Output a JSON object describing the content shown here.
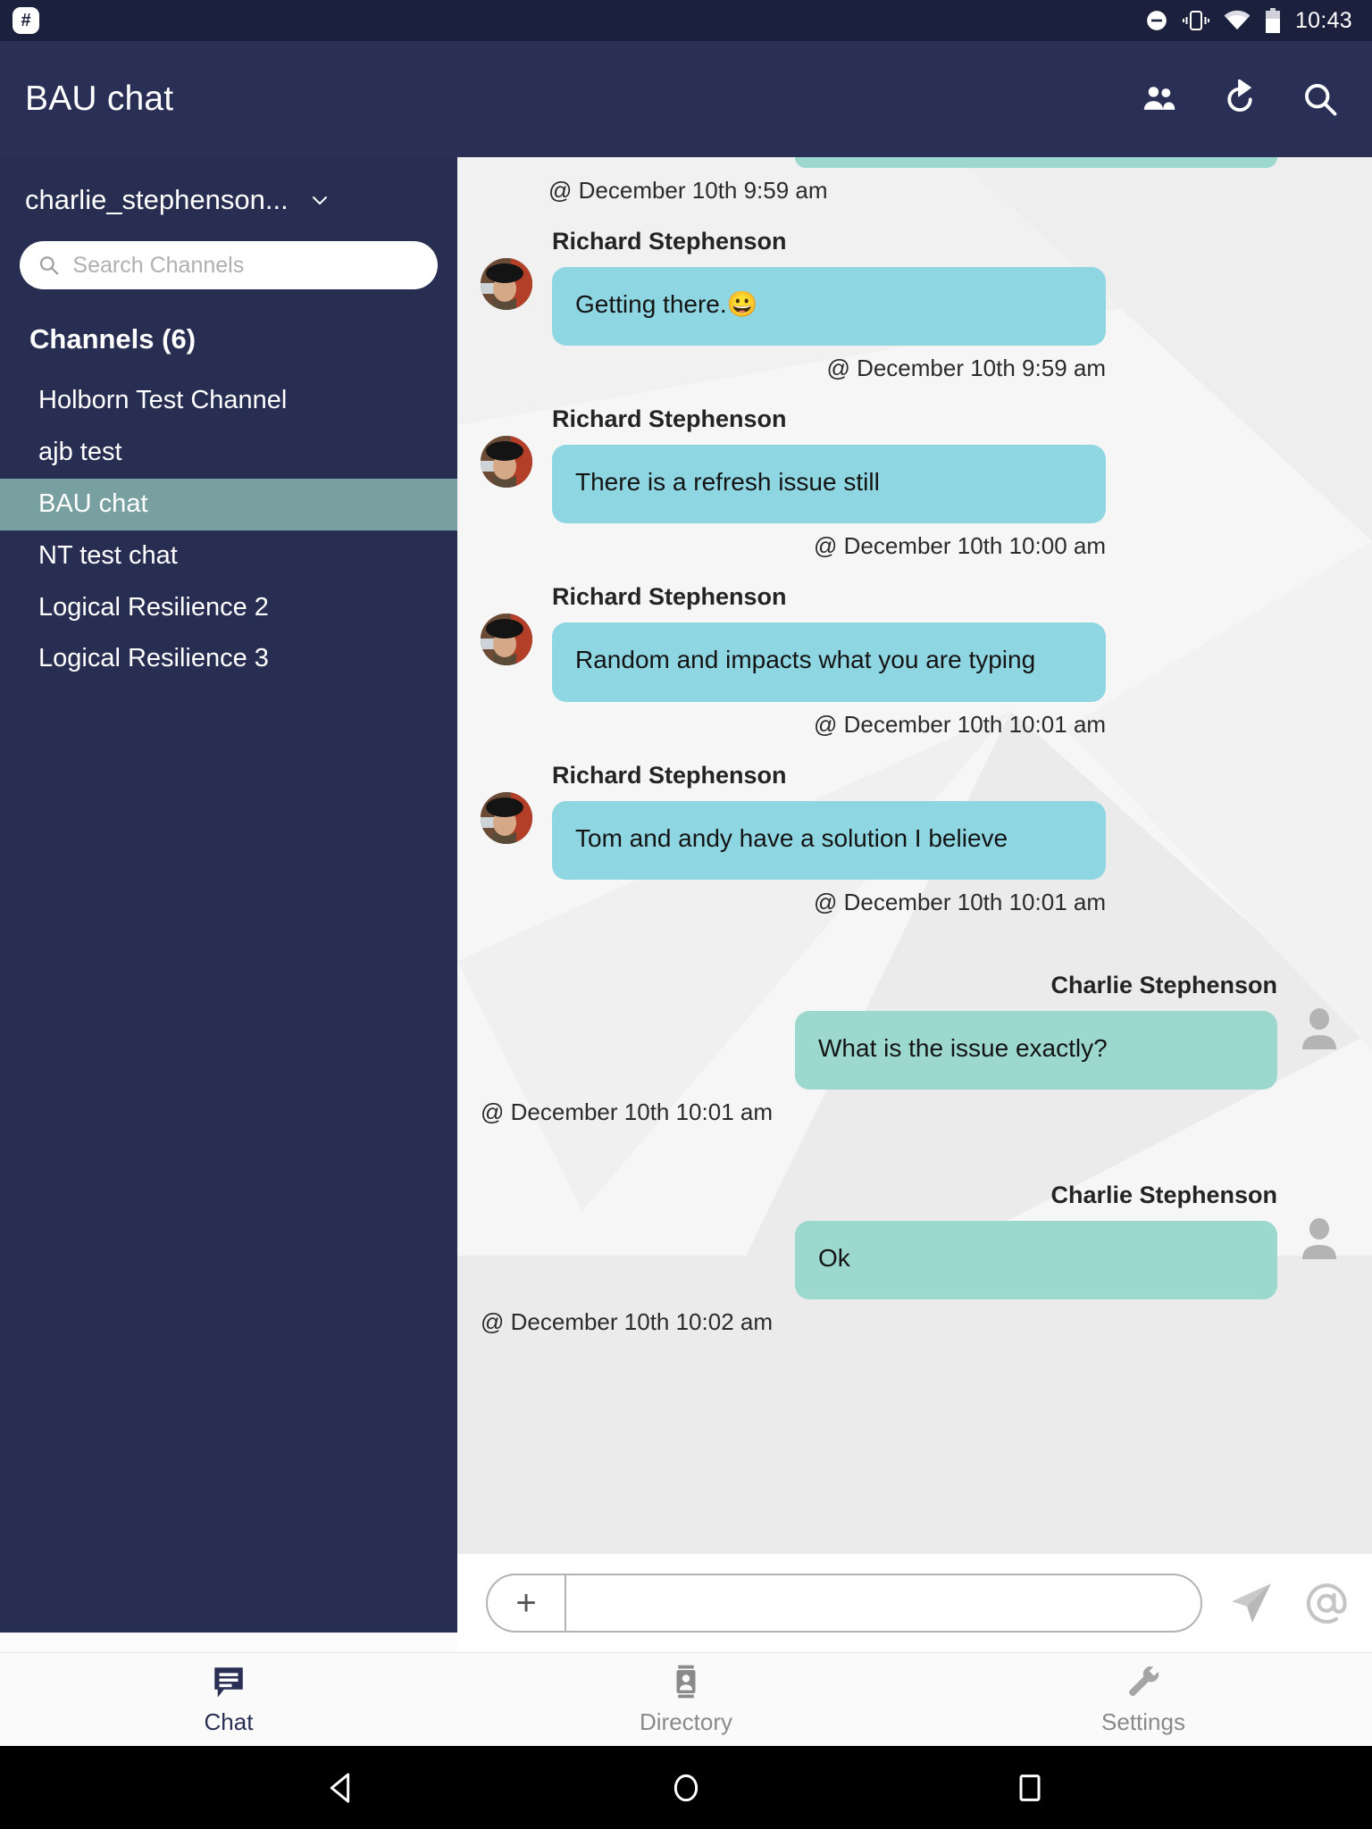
{
  "statusbar": {
    "app_icon": "hash-badge-icon",
    "icons": [
      "do-not-disturb-icon",
      "vibrate-icon",
      "wifi-icon",
      "battery-icon"
    ],
    "clock": "10:43"
  },
  "appbar": {
    "title": "BAU chat",
    "actions": [
      {
        "name": "members-icon",
        "label": "Members"
      },
      {
        "name": "refresh-icon",
        "label": "Refresh"
      },
      {
        "name": "search-icon",
        "label": "Search"
      }
    ]
  },
  "sidebar": {
    "user": "charlie_stephenson...",
    "chevron": "chevron-down-icon",
    "search": {
      "placeholder": "Search Channels",
      "value": "",
      "icon": "search-icon"
    },
    "channels_header": "Channels (6)",
    "channels": [
      {
        "label": "Holborn Test Channel",
        "active": false
      },
      {
        "label": "ajb test",
        "active": false
      },
      {
        "label": "BAU chat",
        "active": true
      },
      {
        "label": "NT test chat",
        "active": false
      },
      {
        "label": "Logical Resilience 2",
        "active": false
      },
      {
        "label": "Logical Resilience 3",
        "active": false
      }
    ]
  },
  "chat": {
    "top_partial_stamp": "@ December 10th 9:59 am",
    "messages": [
      {
        "direction": "in",
        "sender": "Richard Stephenson",
        "text": "Getting there.😀",
        "stamp": "@ December 10th 9:59 am"
      },
      {
        "direction": "in",
        "sender": "Richard Stephenson",
        "text": "There is a refresh issue still",
        "stamp": "@ December 10th 10:00 am"
      },
      {
        "direction": "in",
        "sender": "Richard Stephenson",
        "text": "Random and impacts what you are typing",
        "stamp": "@ December 10th 10:01 am"
      },
      {
        "direction": "in",
        "sender": "Richard Stephenson",
        "text": "Tom and andy have a solution I believe",
        "stamp": "@ December 10th 10:01 am"
      },
      {
        "direction": "out",
        "sender": "Charlie Stephenson",
        "text": "What is the issue exactly?",
        "stamp": "@ December 10th 10:01 am"
      },
      {
        "direction": "out",
        "sender": "Charlie Stephenson",
        "text": "Ok",
        "stamp": "@ December 10th 10:02 am"
      }
    ]
  },
  "composer": {
    "add_label": "+",
    "input_value": "",
    "input_placeholder": "",
    "send_icon": "send-paper-plane-icon",
    "mention_icon": "at-mention-icon"
  },
  "bottomnav": [
    {
      "label": "Chat",
      "icon": "chat-bubble-icon",
      "active": true
    },
    {
      "label": "Directory",
      "icon": "contact-card-icon",
      "active": false
    },
    {
      "label": "Settings",
      "icon": "wrench-icon",
      "active": false
    }
  ],
  "androidnav": [
    {
      "name": "back-icon"
    },
    {
      "name": "home-icon"
    },
    {
      "name": "recents-icon"
    }
  ],
  "colors": {
    "appbar": "#2a3055",
    "sidebar": "#272e51",
    "sidebar_active": "#78a0a0",
    "incoming_bubble": "#8fd6e3",
    "outgoing_bubble": "#9cd8cd",
    "chat_bg": "#f6f6f6",
    "statusbar": "#1b203c"
  }
}
